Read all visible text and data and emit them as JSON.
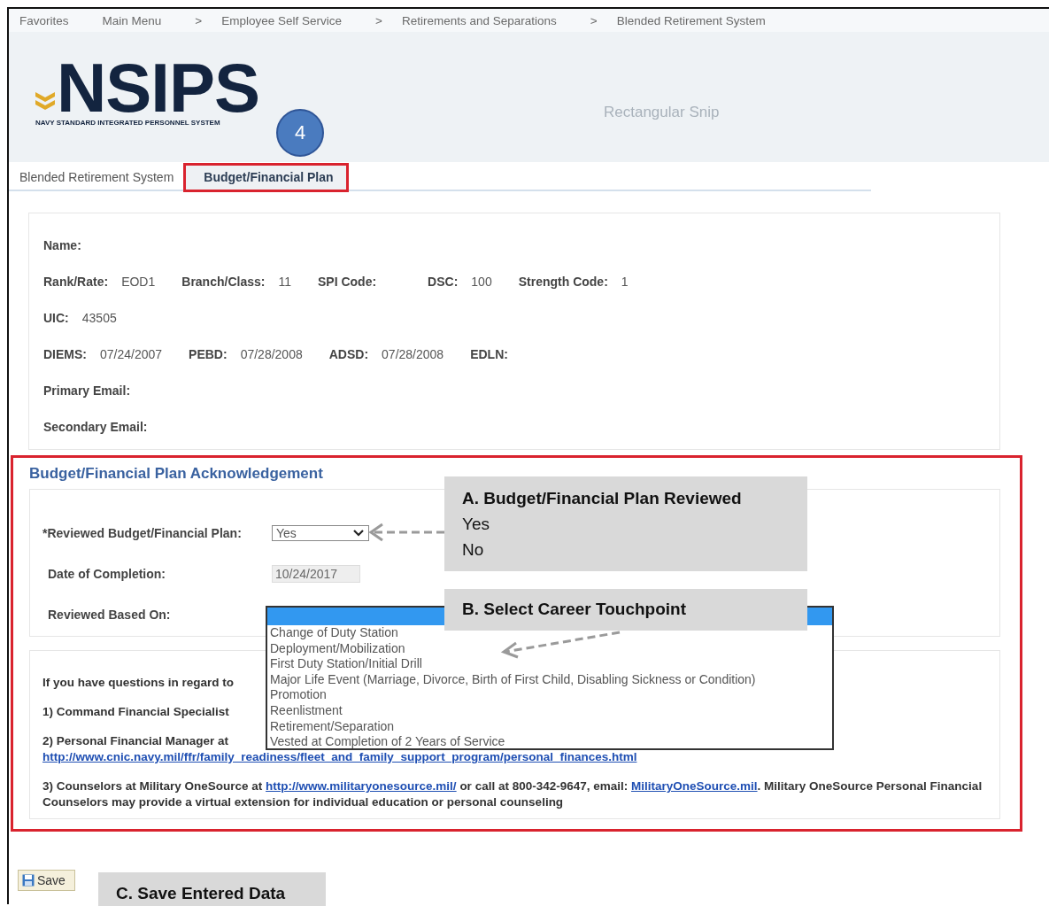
{
  "breadcrumb": [
    {
      "kind": "link",
      "text": "Favorites"
    },
    {
      "kind": "link",
      "text": "Main Menu"
    },
    {
      "kind": "separator",
      "text": ">"
    },
    {
      "kind": "link",
      "text": "Employee Self Service"
    },
    {
      "kind": "separator",
      "text": ">"
    },
    {
      "kind": "link",
      "text": "Retirements and Separations"
    },
    {
      "kind": "separator",
      "text": ">"
    },
    {
      "kind": "link",
      "text": "Blended Retirement System"
    }
  ],
  "header": {
    "wordmark": "NSIPS",
    "tagline": "NAVY STANDARD INTEGRATED PERSONNEL SYSTEM",
    "snip_hint": "Rectangular Snip",
    "step_badge": "4"
  },
  "tabs": [
    {
      "label": "Blended Retirement System",
      "selected": false,
      "annotated": false
    },
    {
      "label": "Budget/Financial Plan",
      "selected": true,
      "annotated": true
    }
  ],
  "profile": {
    "rows": [
      [
        {
          "label": "Name:"
        }
      ],
      [
        {
          "label": "Rank/Rate:",
          "value": "EOD1"
        },
        {
          "label": "Branch/Class:",
          "value": "11"
        },
        {
          "label": "SPI Code:"
        },
        {
          "label": "DSC:",
          "value": "100"
        },
        {
          "label": "Strength Code:",
          "value": "1"
        }
      ],
      [
        {
          "label": "UIC:",
          "value": "43505"
        }
      ],
      [
        {
          "label": "DIEMS:",
          "value": "07/24/2007"
        },
        {
          "label": "PEBD:",
          "value": "07/28/2008"
        },
        {
          "label": "ADSD:",
          "value": "07/28/2008"
        },
        {
          "label": "EDLN:"
        }
      ],
      [
        {
          "label": "Primary Email:"
        }
      ],
      [
        {
          "label": "Secondary Email:"
        }
      ]
    ]
  },
  "acknowledgement": {
    "title": "Budget/Financial Plan Acknowledgement",
    "fields": [
      {
        "kind": "select",
        "label": "*Reviewed Budget/Financial Plan:",
        "value": "Yes"
      },
      {
        "kind": "readonly",
        "label": "Date of Completion:",
        "value": "10/24/2017"
      },
      {
        "kind": "listbox",
        "label": "Reviewed Based On:"
      }
    ],
    "listbox": {
      "blank_selected": true,
      "options": [
        {
          "text": "Change of Duty Station",
          "selected": false
        },
        {
          "text": "Deployment/Mobilization",
          "selected": false
        },
        {
          "text": "First Duty Station/Initial Drill",
          "selected": false
        },
        {
          "text": "Major Life Event (Marriage, Divorce, Birth of First Child, Disabling Sickness or Condition)",
          "selected": false
        },
        {
          "text": "Promotion",
          "selected": false
        },
        {
          "text": "Reenlistment",
          "selected": false
        },
        {
          "text": "Retirement/Separation",
          "selected": false
        },
        {
          "text": "Vested at Completion of 2 Years of Service",
          "selected": false
        }
      ]
    }
  },
  "contacts": [
    [
      {
        "kind": "text",
        "text": "If you have questions in regard to"
      }
    ],
    [
      {
        "kind": "text",
        "text": "1) Command Financial Specialist"
      }
    ],
    [
      {
        "kind": "text",
        "text": "2) Personal Financial Manager at"
      },
      {
        "kind": "break"
      },
      {
        "kind": "link",
        "text": "http://www.cnic.navy.mil/ffr/family_readiness/fleet_and_family_support_program/personal_finances.html"
      }
    ],
    [
      {
        "kind": "text",
        "text": "3) Counselors at Military OneSource at "
      },
      {
        "kind": "link",
        "text": "http://www.militaryonesource.mil/"
      },
      {
        "kind": "text",
        "text": " or call at 800-342-9647, email: "
      },
      {
        "kind": "link",
        "text": "MilitaryOneSource.mil"
      },
      {
        "kind": "text",
        "text": ". Military OneSource Personal Financial Counselors may provide a virtual extension for individual education or personal counseling"
      }
    ]
  ],
  "save_button": {
    "label": "Save"
  },
  "callouts": [
    {
      "title": "A. Budget/Financial Plan Reviewed",
      "lines": [
        "Yes",
        "No"
      ]
    },
    {
      "title": "B. Select Career Touchpoint"
    },
    {
      "title": "C. Save Entered Data"
    }
  ]
}
